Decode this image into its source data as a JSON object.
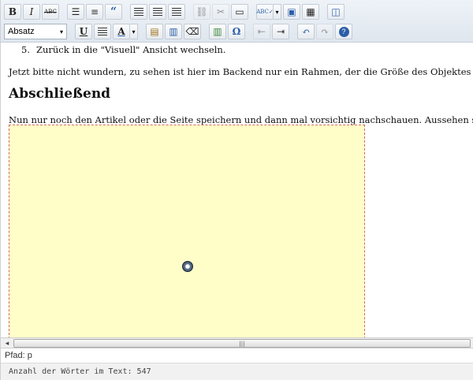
{
  "toolbar": {
    "row1": [
      {
        "name": "bold-button",
        "glyph": "B"
      },
      {
        "name": "italic-button",
        "glyph": "I"
      },
      {
        "name": "strikethrough-button",
        "glyph": "ABC"
      },
      {
        "name": "bullet-list-button",
        "glyph": "☰"
      },
      {
        "name": "numbered-list-button",
        "glyph": "≡"
      },
      {
        "name": "blockquote-button",
        "glyph": "“"
      },
      {
        "name": "align-left-button",
        "glyph": "≡"
      },
      {
        "name": "align-center-button",
        "glyph": "≡"
      },
      {
        "name": "align-right-button",
        "glyph": "≡"
      },
      {
        "name": "insert-link-button",
        "glyph": "⛓"
      },
      {
        "name": "unlink-button",
        "glyph": "✂"
      },
      {
        "name": "insert-more-button",
        "glyph": "▭"
      },
      {
        "name": "spellcheck-button",
        "glyph": "ABC✓"
      },
      {
        "name": "fullscreen-button",
        "glyph": "▣"
      },
      {
        "name": "show-kitchen-sink-button",
        "glyph": "▦"
      },
      {
        "name": "insert-media-button",
        "glyph": "◫"
      }
    ],
    "format_select_value": "Absatz",
    "underline_glyph": "U",
    "text_color_glyph": "A",
    "omega_glyph": "Ω",
    "help_glyph": "?"
  },
  "content": {
    "list_item_number": "5.",
    "list_item_text": "Zurück in die \"Visuell\" Ansicht wechseln.",
    "paragraph1": "Jetzt bitte nicht wundern, zu sehen ist hier im Backend nur ein Rahmen, der die Größe des Objektes darstellt.",
    "heading": "Abschließend",
    "paragraph2": "Nun nur noch den Artikel oder die Seite speichern und dann mal vorsichtig nachschauen. Aussehen soll es so:"
  },
  "scrollbar": {
    "left_arrow": "◂",
    "thumb_grip": "|||"
  },
  "statusbar": {
    "path_label": "Pfad: p",
    "word_count": "Anzahl der Wörter im Text: 547"
  },
  "colors": {
    "placeholder_fill": "#fffdc8",
    "placeholder_border": "#d26a6a",
    "toolbar_bg": "#e6ecf2"
  }
}
